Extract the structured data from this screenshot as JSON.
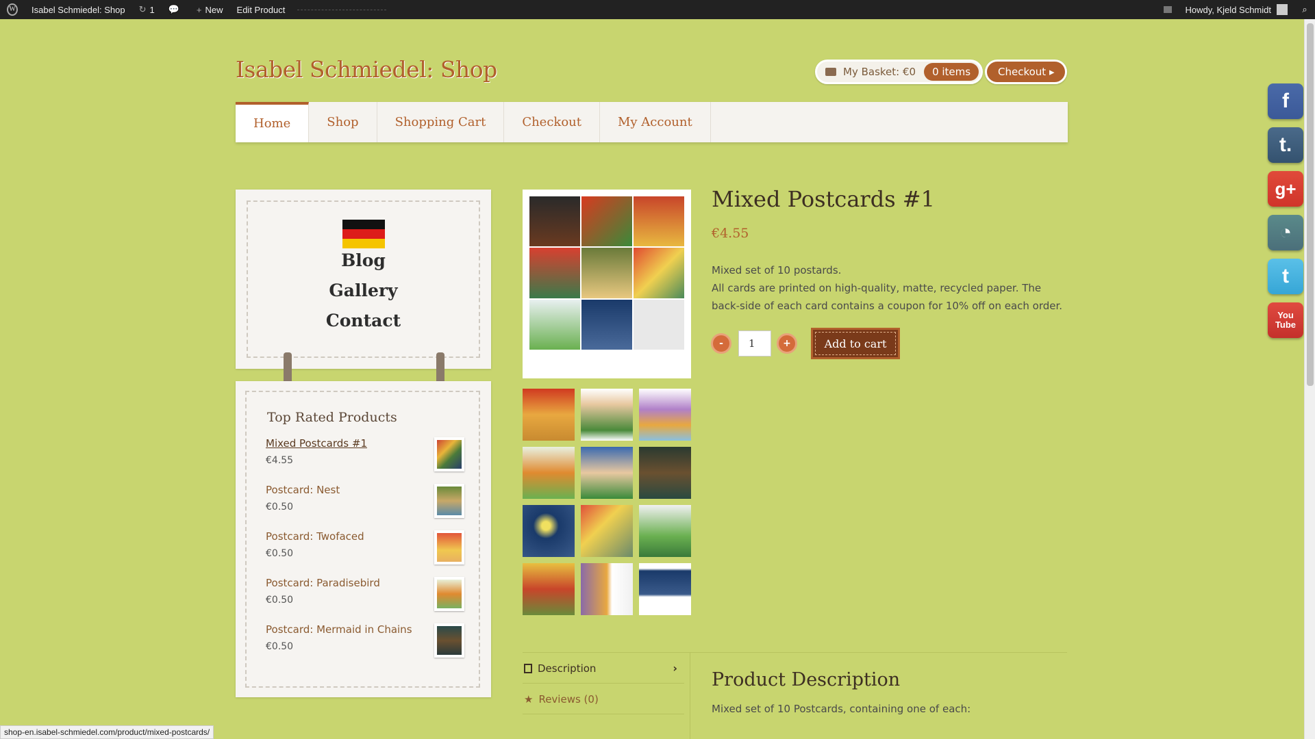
{
  "adminbar": {
    "site_name": "Isabel Schmiedel: Shop",
    "updates_count": "1",
    "new_label": "New",
    "edit_label": "Edit Product",
    "howdy": "Howdy, Kjeld Schmidt"
  },
  "header": {
    "site_title": "Isabel Schmiedel: Shop",
    "basket_label": "My Basket: €0",
    "basket_count": "0 items",
    "checkout_label": "Checkout ▸"
  },
  "nav": {
    "items": [
      {
        "label": "Home"
      },
      {
        "label": "Shop"
      },
      {
        "label": "Shopping Cart"
      },
      {
        "label": "Checkout"
      },
      {
        "label": "My Account"
      }
    ]
  },
  "sidebar": {
    "pages": [
      {
        "label": "Blog"
      },
      {
        "label": "Gallery"
      },
      {
        "label": "Contact"
      }
    ],
    "widget_title": "Top Rated Products",
    "products": [
      {
        "name": "Mixed Postcards #1",
        "price": "€4.55"
      },
      {
        "name": "Postcard: Nest",
        "price": "€0.50"
      },
      {
        "name": "Postcard: Twofaced",
        "price": "€0.50"
      },
      {
        "name": "Postcard: Paradisebird",
        "price": "€0.50"
      },
      {
        "name": "Postcard: Mermaid in Chains",
        "price": "€0.50"
      }
    ]
  },
  "product": {
    "title": "Mixed Postcards #1",
    "price": "€4.55",
    "desc_line1": "Mixed set of 10 postards.",
    "desc_line2": "All cards are printed on high-quality, matte, recycled paper. The back-side of each card contains a coupon for 10% off on each order.",
    "qty": "1",
    "minus": "-",
    "plus": "+",
    "add_to_cart": "Add to cart"
  },
  "tabs": {
    "description": "Description",
    "reviews": "Reviews (0)"
  },
  "product_description": {
    "title": "Product Description",
    "text": "Mixed set of 10 Postcards, containing one of each:"
  },
  "social": [
    {
      "name": "facebook",
      "glyph": "f",
      "color": "#3b5998"
    },
    {
      "name": "tumblr",
      "glyph": "t.",
      "color": "#34526f"
    },
    {
      "name": "google-plus",
      "glyph": "g+",
      "color": "#d0342a"
    },
    {
      "name": "delicious",
      "glyph": "◔",
      "color": "#4b6f7a"
    },
    {
      "name": "twitter",
      "glyph": "t",
      "color": "#36a6d6"
    },
    {
      "name": "youtube",
      "glyph": "You Tube",
      "color": "#c4302b"
    }
  ],
  "statusbar": {
    "url": "shop-en.isabel-schmiedel.com/product/mixed-postcards/"
  }
}
